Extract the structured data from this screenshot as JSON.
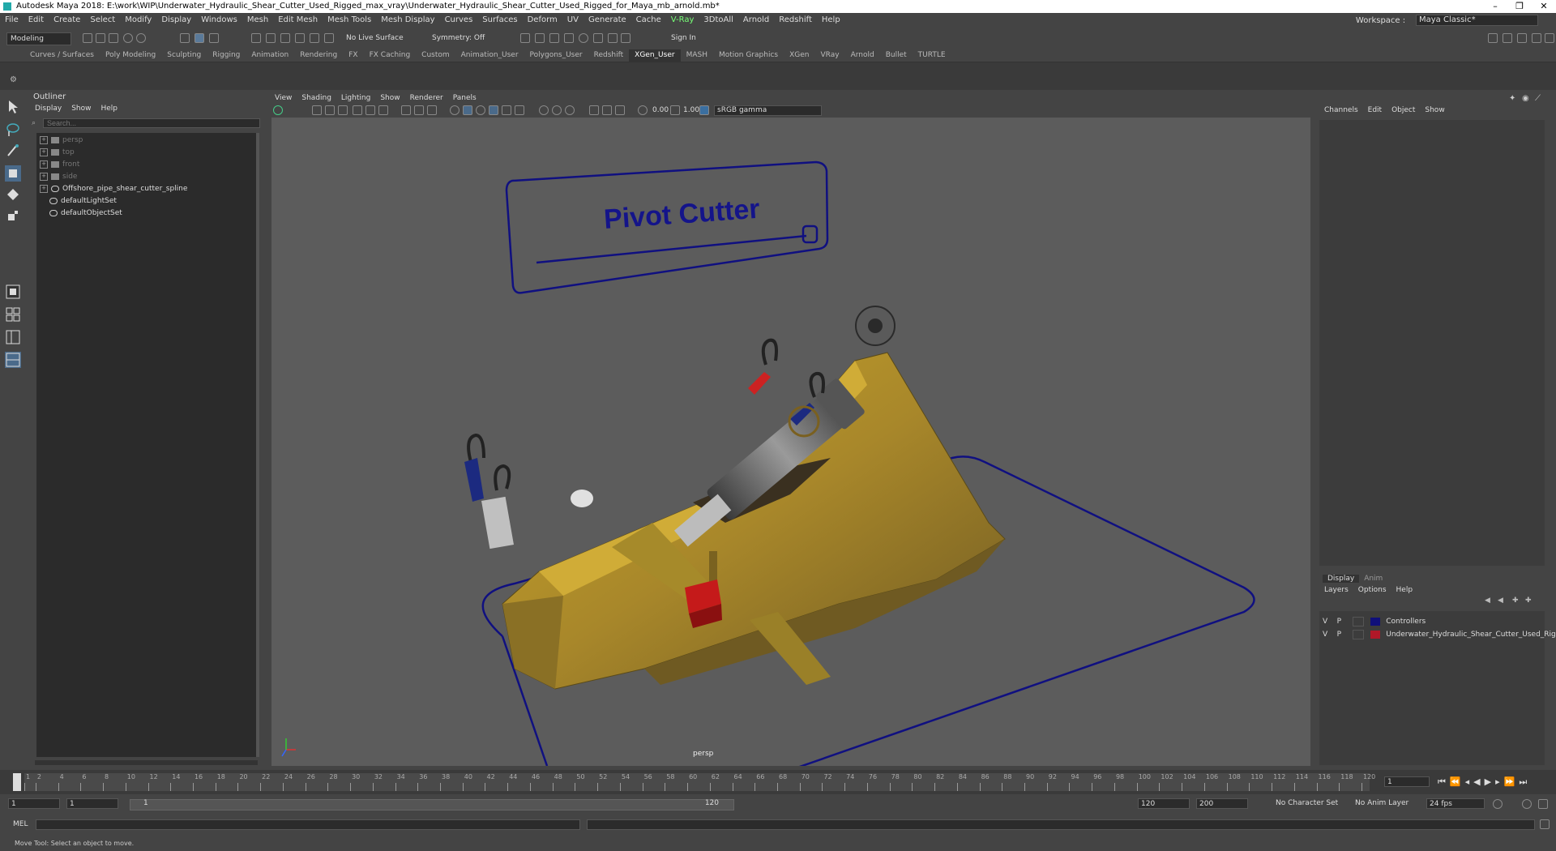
{
  "window": {
    "title": "Autodesk Maya 2018: E:\\work\\WIP\\Underwater_Hydraulic_Shear_Cutter_Used_Rigged_max_vray\\Underwater_Hydraulic_Shear_Cutter_Used_Rigged_for_Maya_mb_arnold.mb*"
  },
  "menubar": {
    "items": [
      "File",
      "Edit",
      "Create",
      "Select",
      "Modify",
      "Display",
      "Windows",
      "Mesh",
      "Edit Mesh",
      "Mesh Tools",
      "Mesh Display",
      "Curves",
      "Surfaces",
      "Deform",
      "UV",
      "Generate",
      "Cache",
      "V-Ray",
      "3DtoAll",
      "Arnold",
      "Redshift",
      "Help"
    ],
    "workspace_label": "Workspace :",
    "workspace_value": "Maya Classic*"
  },
  "statusline": {
    "mode": "Modeling",
    "live_surface": "No Live Surface",
    "symmetry": "Symmetry: Off",
    "sign_in": "Sign In"
  },
  "shelf_tabs": [
    "Curves / Surfaces",
    "Poly Modeling",
    "Sculpting",
    "Rigging",
    "Animation",
    "Rendering",
    "FX",
    "FX Caching",
    "Custom",
    "Animation_User",
    "Polygons_User",
    "Redshift",
    "XGen_User",
    "MASH",
    "Motion Graphics",
    "XGen",
    "VRay",
    "Arnold",
    "Bullet",
    "TURTLE"
  ],
  "active_shelf_tab": "XGen_User",
  "outliner": {
    "title": "Outliner",
    "menu": [
      "Display",
      "Show",
      "Help"
    ],
    "search_placeholder": "Search...",
    "items": [
      {
        "label": "persp",
        "dim": true,
        "type": "camera"
      },
      {
        "label": "top",
        "dim": true,
        "type": "camera"
      },
      {
        "label": "front",
        "dim": true,
        "type": "camera"
      },
      {
        "label": "side",
        "dim": true,
        "type": "camera"
      },
      {
        "label": "Offshore_pipe_shear_cutter_spline",
        "dim": false,
        "type": "transform"
      },
      {
        "label": "defaultLightSet",
        "dim": false,
        "type": "set"
      },
      {
        "label": "defaultObjectSet",
        "dim": false,
        "type": "set"
      }
    ]
  },
  "viewport": {
    "menu": [
      "View",
      "Shading",
      "Lighting",
      "Show",
      "Renderer",
      "Panels"
    ],
    "exposure": "0.00",
    "gamma": "1.00",
    "color_space": "sRGB gamma",
    "camera_label": "persp",
    "controller_text": "Pivot Cutter"
  },
  "channel_box": {
    "menu": [
      "Channels",
      "Edit",
      "Object",
      "Show"
    ]
  },
  "layer_editor": {
    "tabs": [
      "Display",
      "Anim"
    ],
    "menu": [
      "Layers",
      "Options",
      "Help"
    ],
    "layers": [
      {
        "v": "V",
        "p": "P",
        "color": "#10107a",
        "name": "Controllers"
      },
      {
        "v": "V",
        "p": "P",
        "color": "#b01828",
        "name": "Underwater_Hydraulic_Shear_Cutter_Used_Rigged"
      }
    ]
  },
  "timeline": {
    "ticks": [
      "1",
      "2",
      "4",
      "6",
      "8",
      "10",
      "12",
      "14",
      "16",
      "18",
      "20",
      "22",
      "24",
      "26",
      "28",
      "30",
      "32",
      "34",
      "36",
      "38",
      "40",
      "42",
      "44",
      "46",
      "48",
      "50",
      "52",
      "54",
      "56",
      "58",
      "60",
      "62",
      "64",
      "66",
      "68",
      "70",
      "72",
      "74",
      "76",
      "78",
      "80",
      "82",
      "84",
      "86",
      "88",
      "90",
      "92",
      "94",
      "96",
      "98",
      "100",
      "102",
      "104",
      "106",
      "108",
      "110",
      "112",
      "114",
      "116",
      "118",
      "120"
    ],
    "current_frame": "1"
  },
  "range": {
    "start": "1",
    "playback_start": "1",
    "slider_start": "1",
    "slider_end": "120",
    "playback_end": "120",
    "end": "200",
    "character_set": "No Character Set",
    "anim_layer": "No Anim Layer",
    "fps": "24 fps"
  },
  "cmdline": {
    "label": "MEL"
  },
  "helpline": {
    "text": "Move Tool: Select an object to move."
  }
}
